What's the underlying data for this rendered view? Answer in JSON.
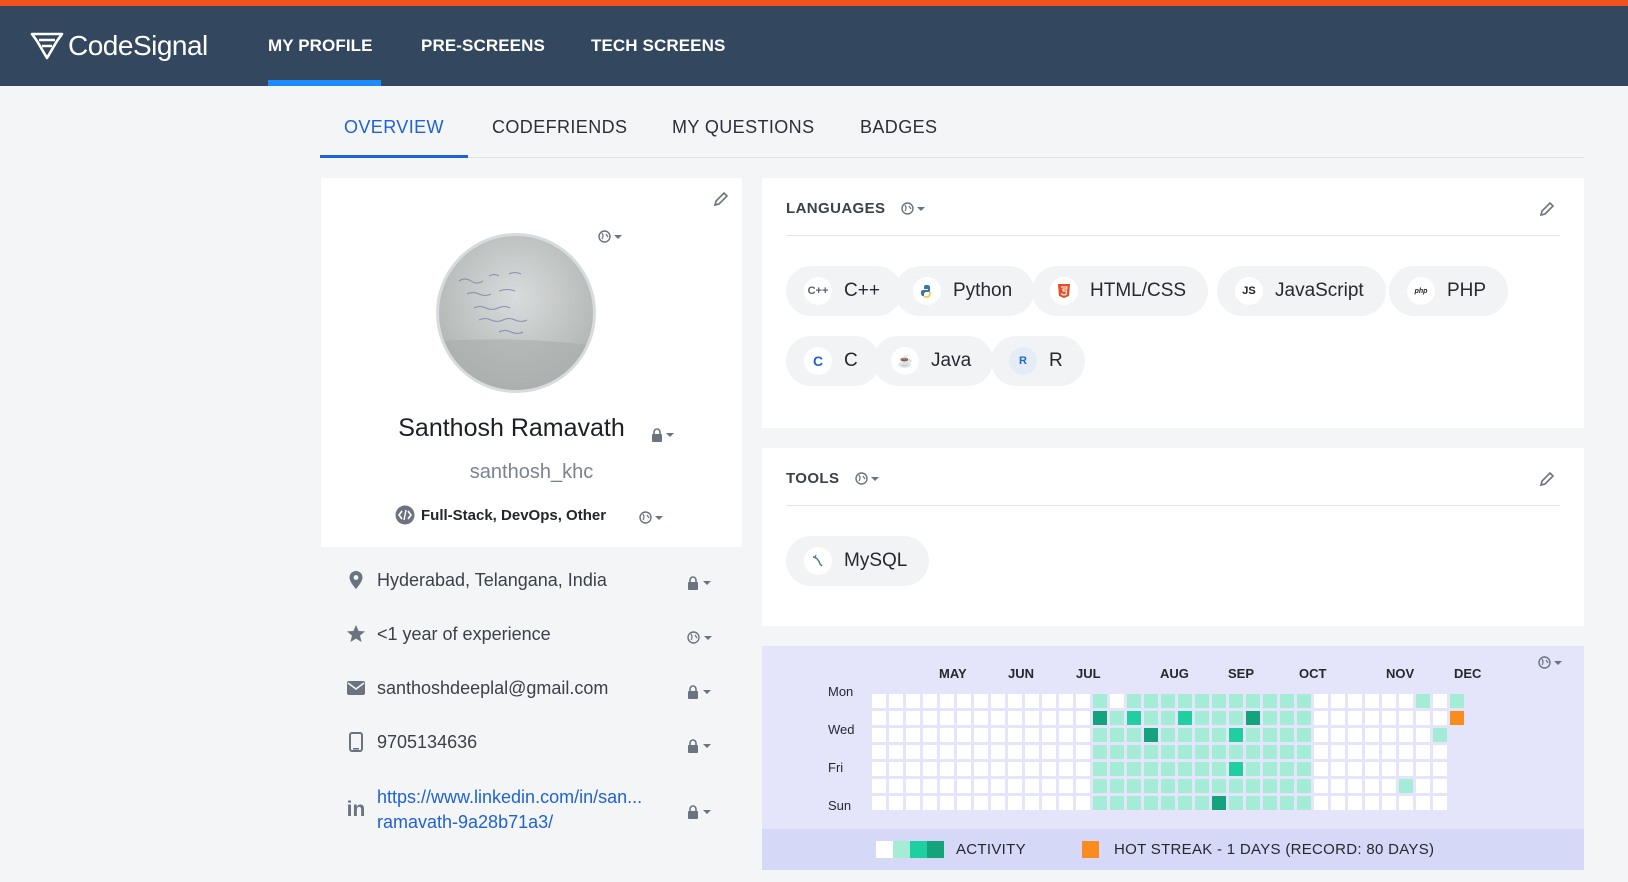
{
  "brand": {
    "name": "CodeSignal"
  },
  "nav": {
    "items": [
      "MY PROFILE",
      "PRE-SCREENS",
      "TECH SCREENS"
    ]
  },
  "tabs": [
    "OVERVIEW",
    "CODEFRIENDS",
    "MY QUESTIONS",
    "BADGES"
  ],
  "profile": {
    "name": "Santhosh Ramavath",
    "username": "santhosh_khc",
    "roles": "Full-Stack, DevOps, Other",
    "location": "Hyderabad, Telangana, India",
    "experience": "<1 year of experience",
    "email": "santhoshdeeplal@gmail.com",
    "phone": "9705134636",
    "linkedin_line1": "https://www.linkedin.com/in/san...",
    "linkedin_line2": "ramavath-9a28b71a3/"
  },
  "languages": {
    "title": "LANGUAGES",
    "items": [
      "C++",
      "Python",
      "HTML/CSS",
      "JavaScript",
      "PHP",
      "C",
      "Java",
      "R"
    ],
    "icons": [
      "cpp-icon",
      "python-icon",
      "html5-icon",
      "js-icon",
      "php-icon",
      "c-icon",
      "java-icon",
      "r-icon"
    ]
  },
  "tools": {
    "title": "TOOLS",
    "items": [
      "MySQL"
    ],
    "icons": [
      "mysql-icon"
    ]
  },
  "activity": {
    "months": [
      "MAY",
      "JUN",
      "JUL",
      "AUG",
      "SEP",
      "OCT",
      "NOV",
      "DEC"
    ],
    "days": [
      "Mon",
      "Wed",
      "Fri",
      "Sun"
    ],
    "legend_activity": "ACTIVITY",
    "legend_streak": "HOT STREAK - 1 DAYS (RECORD: 80 DAYS)",
    "colors": {
      "empty": "#ffffff",
      "level1": "#a5ecd7",
      "level2": "#1fcf9f",
      "level3": "#14a37c",
      "streak": "#f98b1f"
    }
  },
  "colors": {
    "accent": "#1e62d6",
    "topline": "#f0531c",
    "navbar": "#33475e",
    "nav_underline": "#1a8cff"
  }
}
